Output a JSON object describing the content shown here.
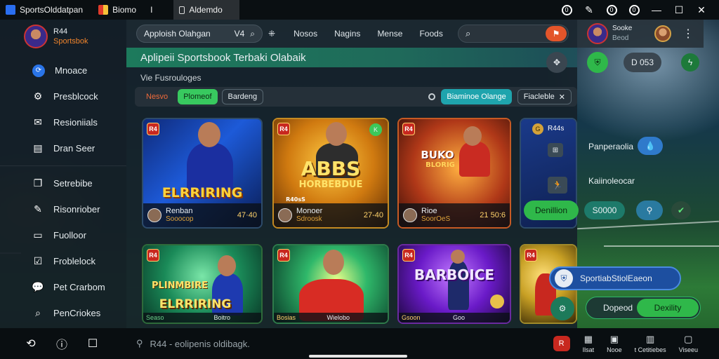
{
  "browser": {
    "tabs": [
      {
        "label": "SportsOlddatpan",
        "icon": "app-icon"
      },
      {
        "label": "Biomo",
        "icon": "flag-icon"
      },
      {
        "label": "Aldemdo",
        "icon": "page-icon"
      }
    ],
    "tab_separator": "I"
  },
  "sidebar": {
    "brand_name": "R44",
    "brand_sub": "Sportsbok",
    "items": [
      {
        "label": "Mnoace",
        "icon": "circle-arrow-icon"
      },
      {
        "label": "Presblcock",
        "icon": "settings-icon"
      },
      {
        "label": "Resioniials",
        "icon": "mail-icon"
      },
      {
        "label": "Dran Seer",
        "icon": "calendar-icon"
      },
      {
        "label": "Setrebibe",
        "icon": "copy-icon"
      },
      {
        "label": "Risonriober",
        "icon": "pen-icon"
      },
      {
        "label": "Fuolloor",
        "icon": "document-icon"
      },
      {
        "label": "Froblelock",
        "icon": "check-icon"
      },
      {
        "label": "Pet Crarbom",
        "icon": "chat-icon"
      },
      {
        "label": "PenCriokes",
        "icon": "search-icon"
      }
    ]
  },
  "header": {
    "app_selector": "Apploish Olahgan",
    "app_selector_code": "V4",
    "nav": [
      "Nosos",
      "Nagins",
      "Mense",
      "Foods"
    ],
    "search_placeholder": ""
  },
  "user": {
    "name": "Sooke",
    "sub": "Beod"
  },
  "main": {
    "title": "Aplipeii Sportsbook Terbaki Olabaik",
    "section": "Vie Fusrouloges",
    "chips": [
      {
        "label": "Nesvo",
        "style": "red"
      },
      {
        "label": "Plomeof",
        "style": "green"
      },
      {
        "label": "Bardeng",
        "style": "outline"
      }
    ],
    "right_chips": [
      {
        "label": "Biaminoe Olange",
        "style": "teal"
      },
      {
        "label": "Fiacleble",
        "style": "outline"
      }
    ]
  },
  "cards": [
    {
      "badge": "R4",
      "headline": "ELRRIRING",
      "name": "Renban",
      "sub": "Sooocop",
      "price": "47·40",
      "theme": "blue"
    },
    {
      "badge": "R4",
      "headline": "ABBS",
      "subhead": "HORBEBDUE",
      "name": "Monoer",
      "sub": "Sdroosk",
      "price": "27-40",
      "theme": "gold",
      "label_top": "R40sS"
    },
    {
      "badge": "R4",
      "headline": "BUKO",
      "subhead": "BLORIG",
      "name": "Rioe",
      "sub": "SoorOeS",
      "price": "21 50:6",
      "theme": "fire"
    },
    {
      "badge": "R4",
      "headline": "",
      "name": "",
      "sub": "",
      "price": "",
      "theme": "partial",
      "top_text": "R44s"
    },
    {
      "badge": "R4",
      "headline": "ELRRIRING",
      "subhead": "PLINMBIRE",
      "name": "Seaso",
      "sub": "Boitro",
      "price": "",
      "theme": "green"
    },
    {
      "badge": "R4",
      "headline": "",
      "name": "Bosias",
      "sub": "Wielobo",
      "price": "",
      "theme": "emerald"
    },
    {
      "badge": "R4",
      "headline": "BARBOICE",
      "name": "Gsoon",
      "sub": "Goo",
      "price": "",
      "theme": "purple"
    },
    {
      "badge": "R4",
      "headline": "",
      "name": "",
      "sub": "",
      "price": "",
      "theme": "partial2"
    }
  ],
  "floating": {
    "top_pill": "D 053",
    "label1": "Panperaolia",
    "label2": "Kaiinoleocar",
    "btn_green": "Denillion",
    "pill_value": "S0000",
    "popup": "SportiabStiolEaeon",
    "bottom_left": "Dopeod",
    "bottom_right": "Dexility"
  },
  "bottombar": {
    "search_text": "R44 - eolipenis oldibagk.",
    "tabs": [
      {
        "label": "Ilsat",
        "icon": "video-icon"
      },
      {
        "label": "Nooe",
        "icon": "card-icon"
      },
      {
        "label": "t Cetitiebes",
        "icon": "grid-icon"
      },
      {
        "label": "Viseeu",
        "icon": "bookmark-icon"
      }
    ],
    "badge": "R"
  }
}
